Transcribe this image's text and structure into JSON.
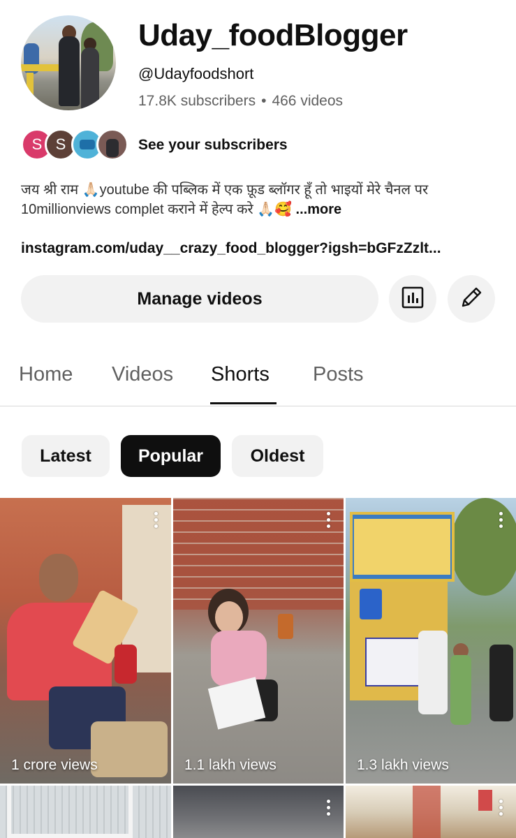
{
  "channel": {
    "name": "Uday_foodBlogger",
    "handle": "@Udayfoodshort",
    "subscribers": "17.8K subscribers",
    "separator": "•",
    "videos": "466 videos"
  },
  "subscribers_row": {
    "avatars": [
      "S",
      "S"
    ],
    "label": "See your subscribers"
  },
  "description": {
    "text": "जय श्री राम 🙏🏻youtube की पब्लिक में एक फ़ूड ब्लॉगर हूँ तो भाइयों मेरे चैनल पर 10millionviews complet कराने में हेल्प करे 🙏🏻🥰 ",
    "more": "...more"
  },
  "link": "instagram.com/uday__crazy_food_blogger?igsh=bGFzZzlt...",
  "actions": {
    "manage_label": "Manage videos",
    "analytics_icon": "analytics-icon",
    "edit_icon": "pencil-icon"
  },
  "tabs": [
    {
      "label": "Home",
      "active": false
    },
    {
      "label": "Videos",
      "active": false
    },
    {
      "label": "Shorts",
      "active": true
    },
    {
      "label": "Posts",
      "active": false
    }
  ],
  "filters": [
    {
      "label": "Latest",
      "selected": false
    },
    {
      "label": "Popular",
      "selected": true
    },
    {
      "label": "Oldest",
      "selected": false
    }
  ],
  "shorts": [
    {
      "views": "1 crore views"
    },
    {
      "views": "1.1 lakh views"
    },
    {
      "views": "1.3 lakh views"
    }
  ],
  "colors": {
    "primary_text": "#0f0f0f",
    "secondary_text": "#606060",
    "chip_bg": "#f2f2f2",
    "chip_selected_bg": "#0f0f0f"
  }
}
